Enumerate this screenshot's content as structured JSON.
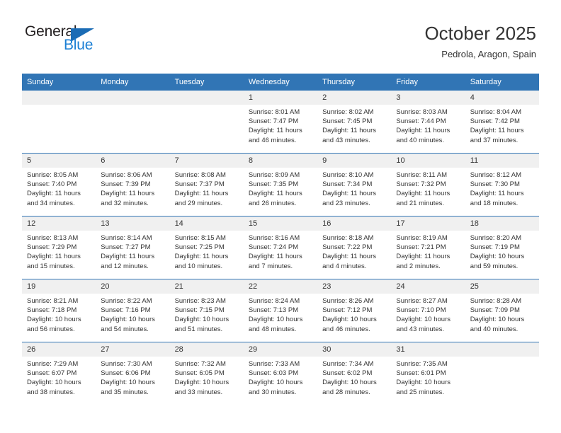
{
  "logo": {
    "word_top": "General",
    "word_bottom": "Blue",
    "triangle_icon": "triangle-icon",
    "color_black": "#231f20",
    "color_blue": "#1b7fd4"
  },
  "header": {
    "month_title": "October 2025",
    "location": "Pedrola, Aragon, Spain",
    "accent_color": "#3175b5"
  },
  "weekday_headers": [
    "Sunday",
    "Monday",
    "Tuesday",
    "Wednesday",
    "Thursday",
    "Friday",
    "Saturday"
  ],
  "weeks": [
    [
      {
        "day": "",
        "sunrise": "",
        "sunset": "",
        "daylight_line1": "",
        "daylight_line2": ""
      },
      {
        "day": "",
        "sunrise": "",
        "sunset": "",
        "daylight_line1": "",
        "daylight_line2": ""
      },
      {
        "day": "",
        "sunrise": "",
        "sunset": "",
        "daylight_line1": "",
        "daylight_line2": ""
      },
      {
        "day": "1",
        "sunrise": "Sunrise: 8:01 AM",
        "sunset": "Sunset: 7:47 PM",
        "daylight_line1": "Daylight: 11 hours",
        "daylight_line2": "and 46 minutes."
      },
      {
        "day": "2",
        "sunrise": "Sunrise: 8:02 AM",
        "sunset": "Sunset: 7:45 PM",
        "daylight_line1": "Daylight: 11 hours",
        "daylight_line2": "and 43 minutes."
      },
      {
        "day": "3",
        "sunrise": "Sunrise: 8:03 AM",
        "sunset": "Sunset: 7:44 PM",
        "daylight_line1": "Daylight: 11 hours",
        "daylight_line2": "and 40 minutes."
      },
      {
        "day": "4",
        "sunrise": "Sunrise: 8:04 AM",
        "sunset": "Sunset: 7:42 PM",
        "daylight_line1": "Daylight: 11 hours",
        "daylight_line2": "and 37 minutes."
      }
    ],
    [
      {
        "day": "5",
        "sunrise": "Sunrise: 8:05 AM",
        "sunset": "Sunset: 7:40 PM",
        "daylight_line1": "Daylight: 11 hours",
        "daylight_line2": "and 34 minutes."
      },
      {
        "day": "6",
        "sunrise": "Sunrise: 8:06 AM",
        "sunset": "Sunset: 7:39 PM",
        "daylight_line1": "Daylight: 11 hours",
        "daylight_line2": "and 32 minutes."
      },
      {
        "day": "7",
        "sunrise": "Sunrise: 8:08 AM",
        "sunset": "Sunset: 7:37 PM",
        "daylight_line1": "Daylight: 11 hours",
        "daylight_line2": "and 29 minutes."
      },
      {
        "day": "8",
        "sunrise": "Sunrise: 8:09 AM",
        "sunset": "Sunset: 7:35 PM",
        "daylight_line1": "Daylight: 11 hours",
        "daylight_line2": "and 26 minutes."
      },
      {
        "day": "9",
        "sunrise": "Sunrise: 8:10 AM",
        "sunset": "Sunset: 7:34 PM",
        "daylight_line1": "Daylight: 11 hours",
        "daylight_line2": "and 23 minutes."
      },
      {
        "day": "10",
        "sunrise": "Sunrise: 8:11 AM",
        "sunset": "Sunset: 7:32 PM",
        "daylight_line1": "Daylight: 11 hours",
        "daylight_line2": "and 21 minutes."
      },
      {
        "day": "11",
        "sunrise": "Sunrise: 8:12 AM",
        "sunset": "Sunset: 7:30 PM",
        "daylight_line1": "Daylight: 11 hours",
        "daylight_line2": "and 18 minutes."
      }
    ],
    [
      {
        "day": "12",
        "sunrise": "Sunrise: 8:13 AM",
        "sunset": "Sunset: 7:29 PM",
        "daylight_line1": "Daylight: 11 hours",
        "daylight_line2": "and 15 minutes."
      },
      {
        "day": "13",
        "sunrise": "Sunrise: 8:14 AM",
        "sunset": "Sunset: 7:27 PM",
        "daylight_line1": "Daylight: 11 hours",
        "daylight_line2": "and 12 minutes."
      },
      {
        "day": "14",
        "sunrise": "Sunrise: 8:15 AM",
        "sunset": "Sunset: 7:25 PM",
        "daylight_line1": "Daylight: 11 hours",
        "daylight_line2": "and 10 minutes."
      },
      {
        "day": "15",
        "sunrise": "Sunrise: 8:16 AM",
        "sunset": "Sunset: 7:24 PM",
        "daylight_line1": "Daylight: 11 hours",
        "daylight_line2": "and 7 minutes."
      },
      {
        "day": "16",
        "sunrise": "Sunrise: 8:18 AM",
        "sunset": "Sunset: 7:22 PM",
        "daylight_line1": "Daylight: 11 hours",
        "daylight_line2": "and 4 minutes."
      },
      {
        "day": "17",
        "sunrise": "Sunrise: 8:19 AM",
        "sunset": "Sunset: 7:21 PM",
        "daylight_line1": "Daylight: 11 hours",
        "daylight_line2": "and 2 minutes."
      },
      {
        "day": "18",
        "sunrise": "Sunrise: 8:20 AM",
        "sunset": "Sunset: 7:19 PM",
        "daylight_line1": "Daylight: 10 hours",
        "daylight_line2": "and 59 minutes."
      }
    ],
    [
      {
        "day": "19",
        "sunrise": "Sunrise: 8:21 AM",
        "sunset": "Sunset: 7:18 PM",
        "daylight_line1": "Daylight: 10 hours",
        "daylight_line2": "and 56 minutes."
      },
      {
        "day": "20",
        "sunrise": "Sunrise: 8:22 AM",
        "sunset": "Sunset: 7:16 PM",
        "daylight_line1": "Daylight: 10 hours",
        "daylight_line2": "and 54 minutes."
      },
      {
        "day": "21",
        "sunrise": "Sunrise: 8:23 AM",
        "sunset": "Sunset: 7:15 PM",
        "daylight_line1": "Daylight: 10 hours",
        "daylight_line2": "and 51 minutes."
      },
      {
        "day": "22",
        "sunrise": "Sunrise: 8:24 AM",
        "sunset": "Sunset: 7:13 PM",
        "daylight_line1": "Daylight: 10 hours",
        "daylight_line2": "and 48 minutes."
      },
      {
        "day": "23",
        "sunrise": "Sunrise: 8:26 AM",
        "sunset": "Sunset: 7:12 PM",
        "daylight_line1": "Daylight: 10 hours",
        "daylight_line2": "and 46 minutes."
      },
      {
        "day": "24",
        "sunrise": "Sunrise: 8:27 AM",
        "sunset": "Sunset: 7:10 PM",
        "daylight_line1": "Daylight: 10 hours",
        "daylight_line2": "and 43 minutes."
      },
      {
        "day": "25",
        "sunrise": "Sunrise: 8:28 AM",
        "sunset": "Sunset: 7:09 PM",
        "daylight_line1": "Daylight: 10 hours",
        "daylight_line2": "and 40 minutes."
      }
    ],
    [
      {
        "day": "26",
        "sunrise": "Sunrise: 7:29 AM",
        "sunset": "Sunset: 6:07 PM",
        "daylight_line1": "Daylight: 10 hours",
        "daylight_line2": "and 38 minutes."
      },
      {
        "day": "27",
        "sunrise": "Sunrise: 7:30 AM",
        "sunset": "Sunset: 6:06 PM",
        "daylight_line1": "Daylight: 10 hours",
        "daylight_line2": "and 35 minutes."
      },
      {
        "day": "28",
        "sunrise": "Sunrise: 7:32 AM",
        "sunset": "Sunset: 6:05 PM",
        "daylight_line1": "Daylight: 10 hours",
        "daylight_line2": "and 33 minutes."
      },
      {
        "day": "29",
        "sunrise": "Sunrise: 7:33 AM",
        "sunset": "Sunset: 6:03 PM",
        "daylight_line1": "Daylight: 10 hours",
        "daylight_line2": "and 30 minutes."
      },
      {
        "day": "30",
        "sunrise": "Sunrise: 7:34 AM",
        "sunset": "Sunset: 6:02 PM",
        "daylight_line1": "Daylight: 10 hours",
        "daylight_line2": "and 28 minutes."
      },
      {
        "day": "31",
        "sunrise": "Sunrise: 7:35 AM",
        "sunset": "Sunset: 6:01 PM",
        "daylight_line1": "Daylight: 10 hours",
        "daylight_line2": "and 25 minutes."
      },
      {
        "day": "",
        "sunrise": "",
        "sunset": "",
        "daylight_line1": "",
        "daylight_line2": ""
      }
    ]
  ]
}
